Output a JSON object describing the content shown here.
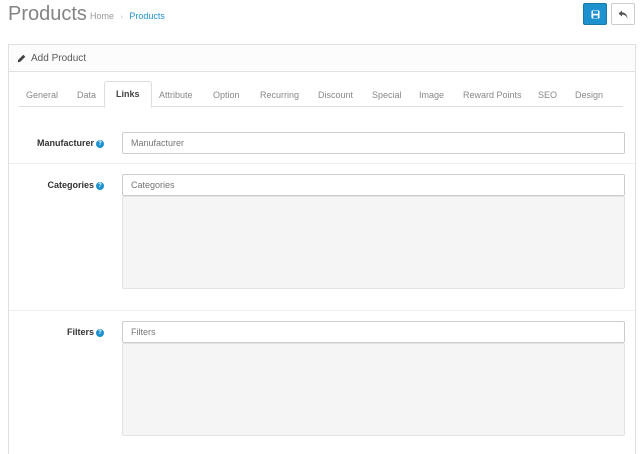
{
  "header": {
    "title": "Products",
    "breadcrumb": {
      "home": "Home",
      "separator": "›",
      "current": "Products"
    },
    "save_button_color": "#1e91cf"
  },
  "panel": {
    "heading": "Add Product",
    "heading_icon": "pencil-icon"
  },
  "tabs": [
    {
      "label": "General"
    },
    {
      "label": "Data"
    },
    {
      "label": "Links",
      "active": true
    },
    {
      "label": "Attribute"
    },
    {
      "label": "Option"
    },
    {
      "label": "Recurring"
    },
    {
      "label": "Discount"
    },
    {
      "label": "Special"
    },
    {
      "label": "Image"
    },
    {
      "label": "Reward Points"
    },
    {
      "label": "SEO"
    },
    {
      "label": "Design"
    }
  ],
  "form": {
    "manufacturer": {
      "label": "Manufacturer",
      "placeholder": "Manufacturer",
      "value": ""
    },
    "categories": {
      "label": "Categories",
      "placeholder": "Categories",
      "value": ""
    },
    "filters": {
      "label": "Filters",
      "placeholder": "Filters",
      "value": ""
    }
  },
  "help_glyph": "?"
}
